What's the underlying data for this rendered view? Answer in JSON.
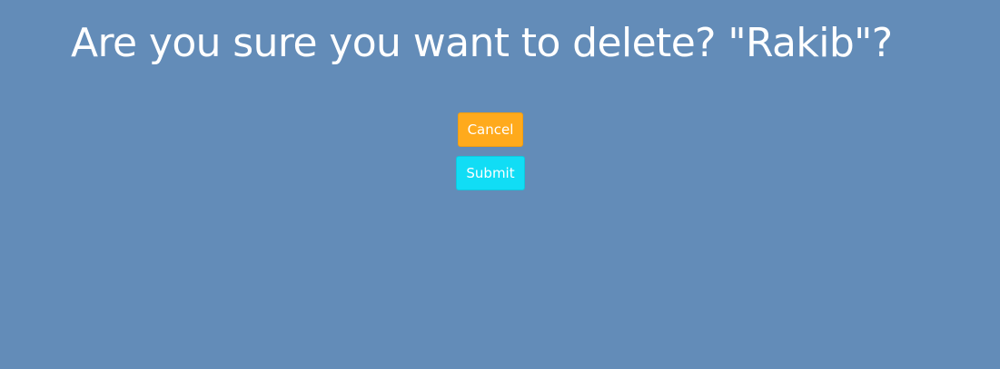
{
  "dialog": {
    "title": "Are you sure you want to delete? \"Rakib\"?",
    "cancel_label": "Cancel",
    "submit_label": "Submit"
  },
  "colors": {
    "background": "#638cb8",
    "cancel_button": "#ffaa1c",
    "submit_button": "#11ddf5",
    "text": "#ffffff"
  }
}
